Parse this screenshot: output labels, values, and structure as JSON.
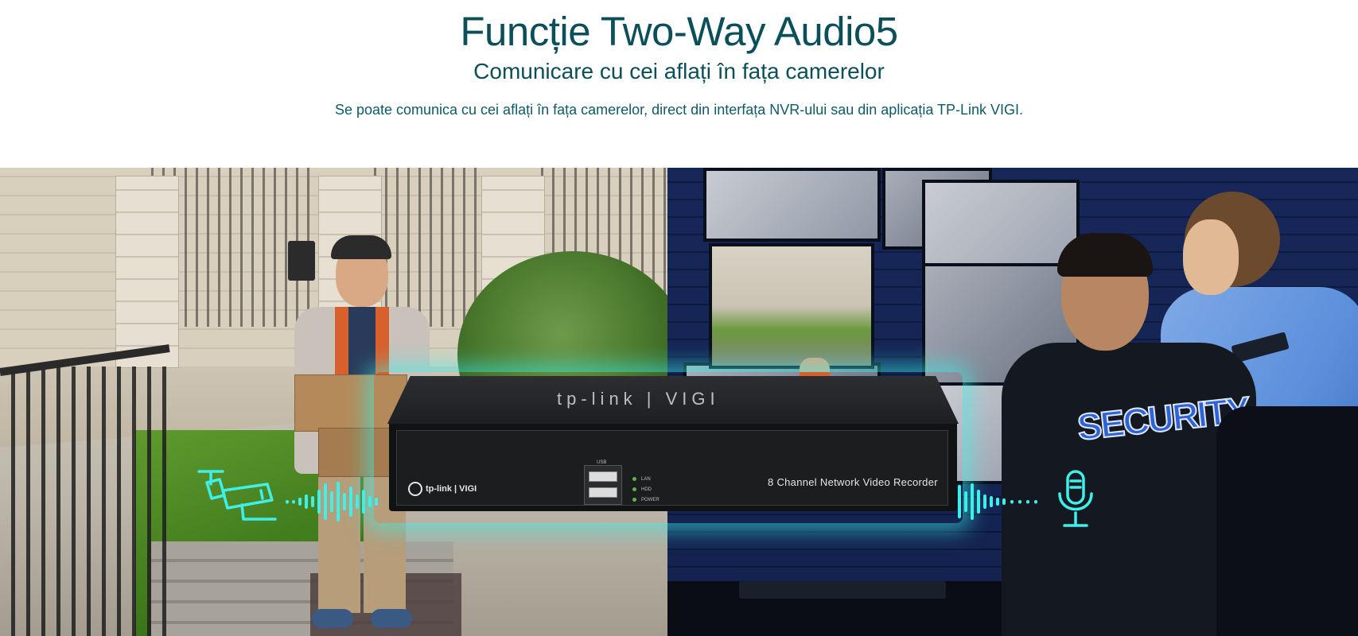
{
  "header": {
    "title": "Funcție Two-Way Audio5",
    "subtitle": "Comunicare cu cei aflați în fața camerelor",
    "description": "Se poate comunica cu cei aflați în fața camerelor, direct din interfața NVR-ului sau din aplicația TP-Link VIGI."
  },
  "hero": {
    "left_scene": "Courier at gate with parcels",
    "right_scene": "Security guards watching monitors",
    "guard_patch": "SECURITY",
    "device": {
      "top_logo": "tp-link | VIGI",
      "front_logo": "tp-link | VIGI",
      "model": "8 Channel Network Video Recorder",
      "usb_label": "USB",
      "leds": [
        "LAN",
        "HDD",
        "POWER"
      ]
    },
    "icons": {
      "left": "security-camera-icon",
      "right": "microphone-icon"
    },
    "accent_color": "#38f0eb"
  }
}
